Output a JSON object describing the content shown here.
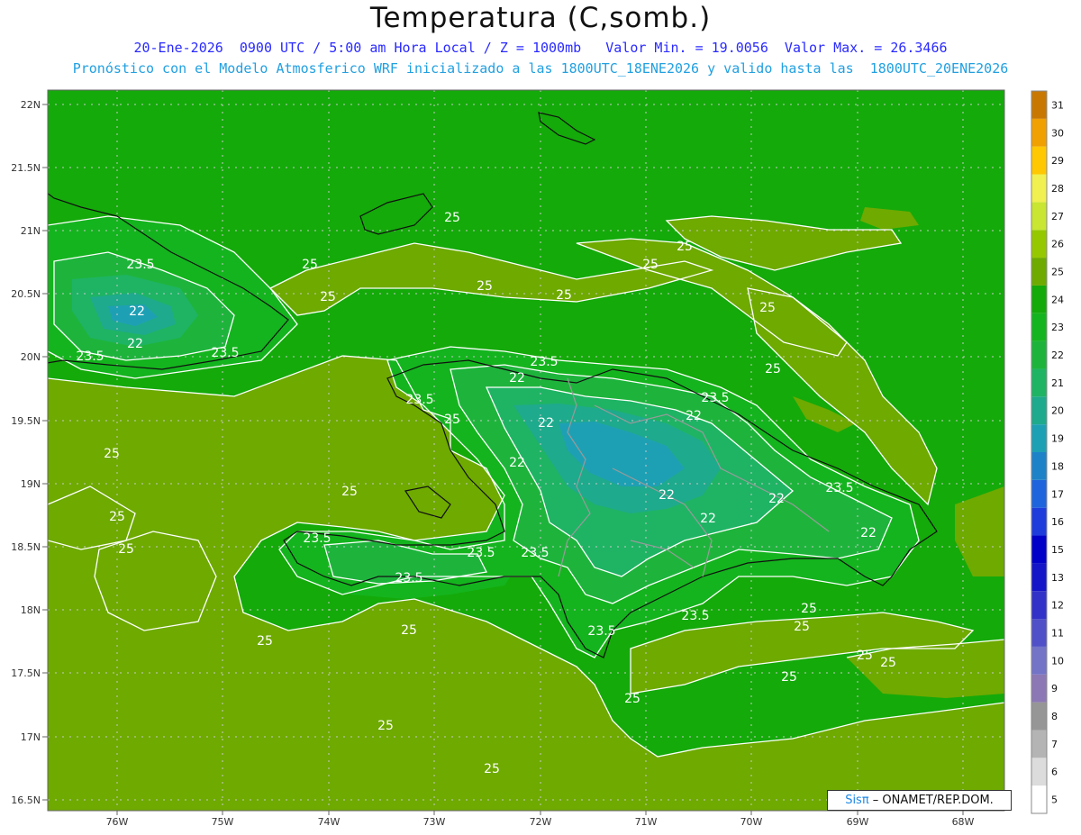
{
  "header": {
    "title": "Temperatura (C,somb.)",
    "subtitle1": "20-Ene-2026  0900 UTC / 5:00 am Hora Local / Z = 1000mb   Valor Min. = 19.0056  Valor Max. = 26.3466",
    "subtitle2": "Pronóstico con el Modelo Atmosferico WRF inicializado a las 1800UTC_18ENE2026 y valido hasta las  1800UTC_20ENE2026"
  },
  "credit": {
    "sis": "Sisπ",
    "rest": " – ONAMET/REP.DOM."
  },
  "axes": {
    "lat_labels": [
      "22N",
      "21.5N",
      "21N",
      "20.5N",
      "20N",
      "19.5N",
      "19N",
      "18.5N",
      "18N",
      "17.5N",
      "17N",
      "16.5N"
    ],
    "lon_labels": [
      "76W",
      "75W",
      "74W",
      "73W",
      "72W",
      "71W",
      "70W",
      "69W",
      "68W"
    ]
  },
  "colorbar": {
    "levels": [
      "5",
      "6",
      "7",
      "8",
      "9",
      "10",
      "11",
      "12",
      "13",
      "15",
      "16",
      "17",
      "18",
      "19",
      "20",
      "21",
      "22",
      "23",
      "24",
      "25",
      "26",
      "27",
      "28",
      "29",
      "30",
      "31"
    ],
    "colors": [
      "#ffffff",
      "#dcdcdc",
      "#b4b4b4",
      "#969696",
      "#8c78b4",
      "#7373c8",
      "#5050c8",
      "#3232c8",
      "#1414c8",
      "#0000c8",
      "#1e3cdc",
      "#1e64dc",
      "#1e82c8",
      "#1ea0b4",
      "#1eaa8c",
      "#1eb464",
      "#1eb43c",
      "#14b41e",
      "#14aa0a",
      "#6eaa00",
      "#96c800",
      "#c8e632",
      "#f0f050",
      "#ffc800",
      "#f0a000",
      "#c87800"
    ]
  },
  "contour_labels": [
    {
      "text": "25"
    },
    {
      "text": "25"
    },
    {
      "text": "25"
    },
    {
      "text": "25"
    },
    {
      "text": "25"
    },
    {
      "text": "25"
    },
    {
      "text": "25"
    },
    {
      "text": "25"
    },
    {
      "text": "25"
    },
    {
      "text": "25"
    },
    {
      "text": "25"
    },
    {
      "text": "25"
    },
    {
      "text": "25"
    },
    {
      "text": "25"
    },
    {
      "text": "25"
    },
    {
      "text": "25"
    },
    {
      "text": "25"
    },
    {
      "text": "25"
    },
    {
      "text": "25"
    },
    {
      "text": "25"
    },
    {
      "text": "25"
    },
    {
      "text": "25"
    },
    {
      "text": "25"
    },
    {
      "text": "25"
    },
    {
      "text": "23.5"
    },
    {
      "text": "23.5"
    },
    {
      "text": "23.5"
    },
    {
      "text": "23.5"
    },
    {
      "text": "23.5"
    },
    {
      "text": "23.5"
    },
    {
      "text": "23.5"
    },
    {
      "text": "23.5"
    },
    {
      "text": "23.5"
    },
    {
      "text": "23.5"
    },
    {
      "text": "23.5"
    },
    {
      "text": "23.5"
    },
    {
      "text": "23.5"
    },
    {
      "text": "22"
    },
    {
      "text": "22"
    },
    {
      "text": "22"
    },
    {
      "text": "22"
    },
    {
      "text": "22"
    },
    {
      "text": "22"
    },
    {
      "text": "22"
    },
    {
      "text": "22"
    },
    {
      "text": "22"
    },
    {
      "text": "22"
    }
  ]
}
